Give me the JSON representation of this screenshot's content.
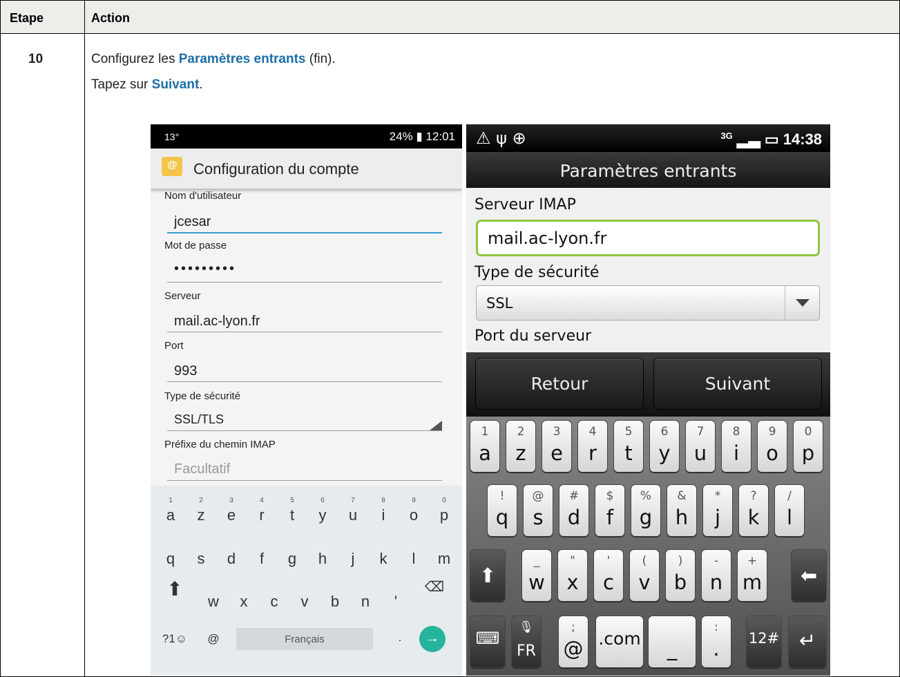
{
  "table": {
    "header": {
      "col1": "Etape",
      "col2": "Action"
    },
    "step": "10",
    "line1": {
      "pre": "Configurez les ",
      "bold": "Paramètres entrants",
      "post": " (fin)."
    },
    "line2": {
      "pre": "Tapez sur ",
      "bold": "Suivant",
      "post": "."
    }
  },
  "left_phone": {
    "status": {
      "left": "13°",
      "right": "24% ▮ 12:01"
    },
    "title": "Configuration du compte",
    "fields": [
      {
        "label": "Nom d'utilisateur",
        "value": "jcesar"
      },
      {
        "label": "Mot de passe",
        "value": "•••••••••"
      },
      {
        "label": "Serveur",
        "value": "mail.ac-lyon.fr"
      },
      {
        "label": "Port",
        "value": "993"
      },
      {
        "label": "Type de sécurité",
        "value": "SSL/TLS"
      },
      {
        "label": "Préfixe du chemin IMAP",
        "placeholder": "Facultatif"
      }
    ],
    "keyboard": {
      "row1": [
        "a",
        "z",
        "e",
        "r",
        "t",
        "y",
        "u",
        "i",
        "o",
        "p"
      ],
      "row1_digits": [
        "1",
        "2",
        "3",
        "4",
        "5",
        "6",
        "7",
        "8",
        "9",
        "0"
      ],
      "row2": [
        "q",
        "s",
        "d",
        "f",
        "g",
        "h",
        "j",
        "k",
        "l",
        "m"
      ],
      "row3": [
        "w",
        "x",
        "c",
        "v",
        "b",
        "n",
        "'"
      ],
      "symbols": "?1☺",
      "at": "@",
      "language": "Français",
      "dot": "."
    }
  },
  "right_phone": {
    "status": {
      "left": "⚠ ψ ⊕",
      "net": "3G",
      "time": "14:38"
    },
    "title": "Paramètres entrants",
    "server_label": "Serveur IMAP",
    "server_value": "mail.ac-lyon.fr",
    "security_label": "Type de sécurité",
    "security_value": "SSL",
    "port_label": "Port du serveur",
    "buttons": {
      "back": "Retour",
      "next": "Suivant"
    },
    "keyboard": {
      "row1": [
        [
          "1",
          "a"
        ],
        [
          "2",
          "z"
        ],
        [
          "3",
          "e"
        ],
        [
          "4",
          "r"
        ],
        [
          "5",
          "t"
        ],
        [
          "6",
          "y"
        ],
        [
          "7",
          "u"
        ],
        [
          "8",
          "i"
        ],
        [
          "9",
          "o"
        ],
        [
          "0",
          "p"
        ]
      ],
      "row2": [
        [
          "!",
          "q"
        ],
        [
          "@",
          "s"
        ],
        [
          "#",
          "d"
        ],
        [
          "$",
          "f"
        ],
        [
          "%",
          "g"
        ],
        [
          "&",
          "h"
        ],
        [
          "*",
          "j"
        ],
        [
          "?",
          "k"
        ],
        [
          "/",
          "l"
        ]
      ],
      "row3": [
        [
          "_",
          "w"
        ],
        [
          "\"",
          "x"
        ],
        [
          "'",
          "c"
        ],
        [
          "(",
          "v"
        ],
        [
          ")",
          "b"
        ],
        [
          "-",
          "n"
        ],
        [
          "+",
          "m"
        ]
      ],
      "lang": "FR",
      "at": "@",
      "com": ".com",
      "num": "12#"
    }
  }
}
